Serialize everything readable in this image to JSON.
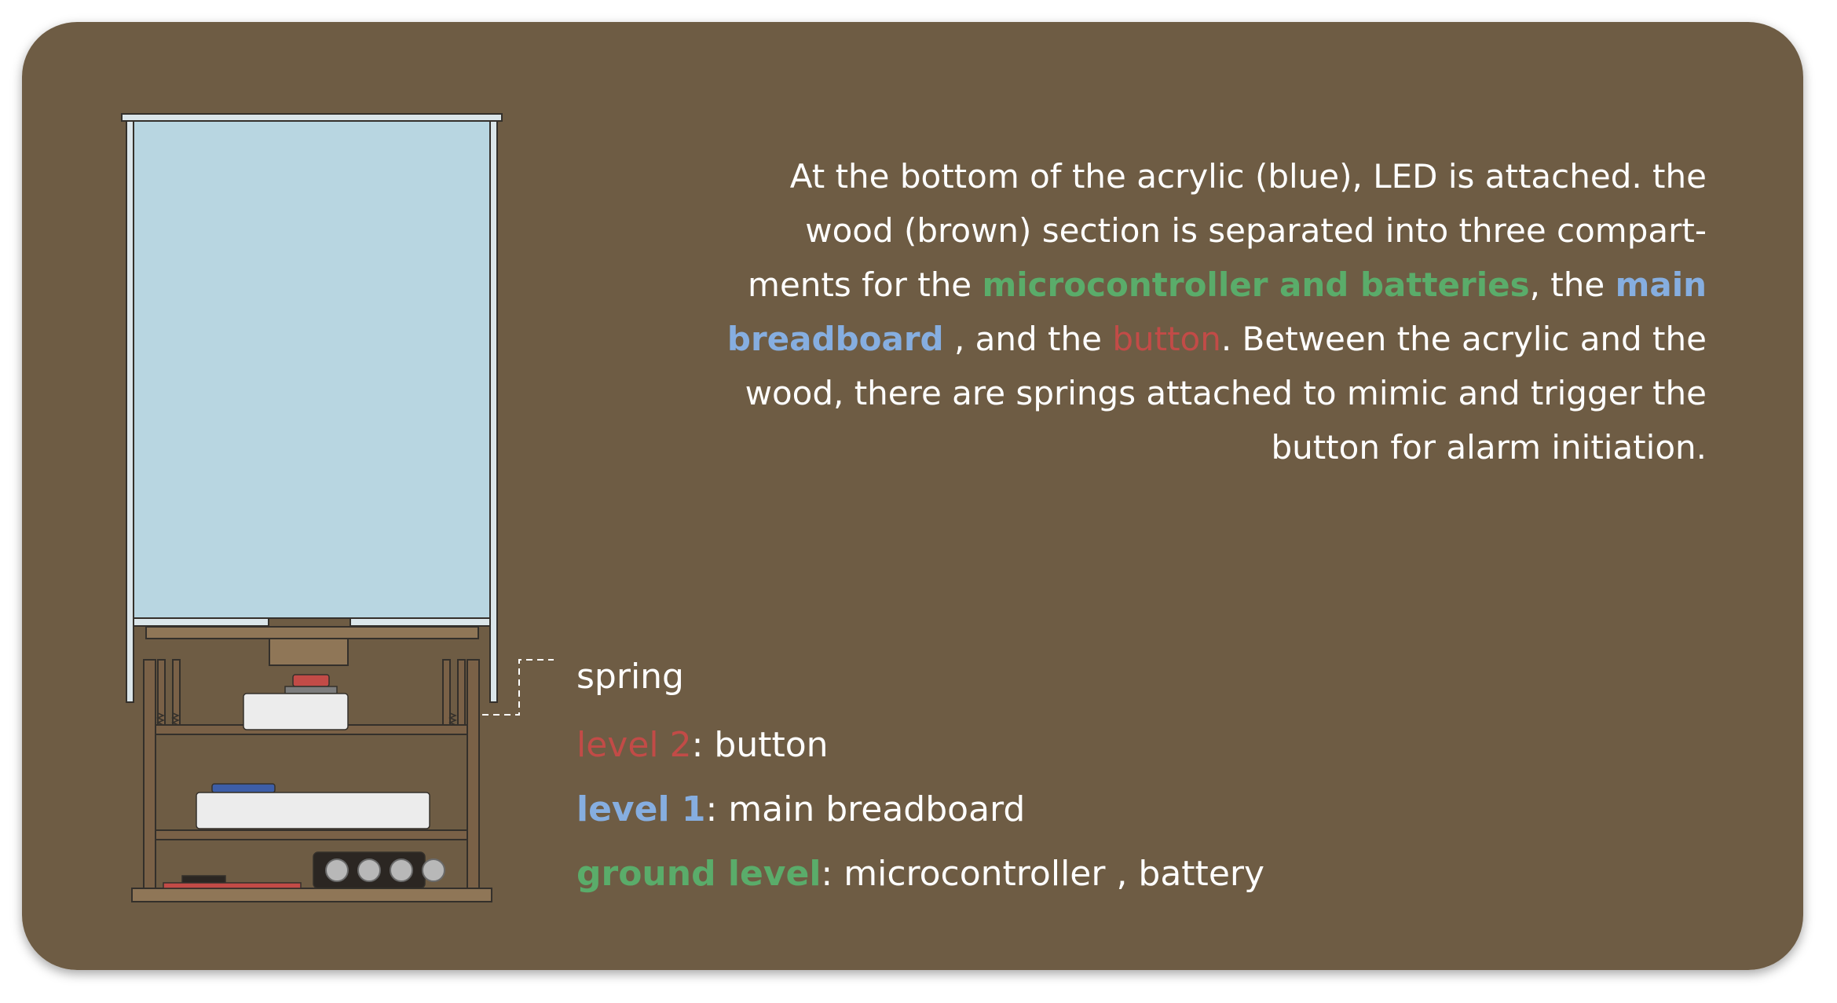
{
  "colors": {
    "background": "#6e5c44",
    "acrylic": "#b8d6e1",
    "wood": "#7a6147",
    "wood_inner": "#6e5c44",
    "outline": "#34302b",
    "accent_green": "#5aac6a",
    "accent_blue": "#86aee0",
    "accent_red": "#c24b47",
    "text": "#ffffff"
  },
  "description": {
    "part1": "At the bottom of the acrylic (blue), LED is attached. the wood (brown) section is separated into three compart-ments for the ",
    "highlight_green": "microcontroller and batteries",
    "part2": ", the ",
    "highlight_blue": "main breadboard",
    "part3": " , and the ",
    "highlight_red": "button",
    "part4": ". Between the acrylic and the wood, there are springs attached to mimic and trigger the button for alarm initiation."
  },
  "labels": {
    "spring": "spring",
    "level2": {
      "name": "level 2",
      "sep": ": ",
      "value": "button"
    },
    "level1": {
      "name": "level 1",
      "sep": ": ",
      "value": "main breadboard"
    },
    "ground": {
      "name": "ground level",
      "sep": ": ",
      "value": "microcontroller , battery"
    }
  },
  "icons": {
    "acrylic": "acrylic-panel",
    "spring": "spring-coil",
    "button": "push-button",
    "breadboard": "breadboard",
    "battery": "battery-pack",
    "microcontroller": "circuit-board"
  }
}
